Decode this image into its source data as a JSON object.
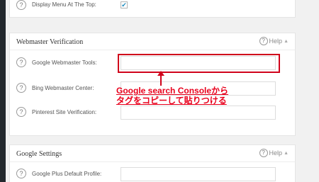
{
  "top_panel": {
    "display_menu_label": "Display Menu At The Top:",
    "display_menu_checked": true
  },
  "webmaster": {
    "title": "Webmaster Verification",
    "help_label": "Help",
    "fields": [
      {
        "label": "Google Webmaster Tools:",
        "value": ""
      },
      {
        "label": "Bing Webmaster Center:",
        "value": ""
      },
      {
        "label": "Pinterest Site Verification:",
        "value": ""
      }
    ]
  },
  "google": {
    "title": "Google Settings",
    "help_label": "Help",
    "fields": [
      {
        "label": "Google Plus Default Profile:",
        "value": ""
      }
    ]
  },
  "annotation": {
    "line1": "Google search Consoleから",
    "line2": "タグをコピーして貼りつける",
    "color": "#e8001c"
  },
  "colors": {
    "highlight": "#d0021b",
    "checkmark": "#1e8cbe"
  }
}
